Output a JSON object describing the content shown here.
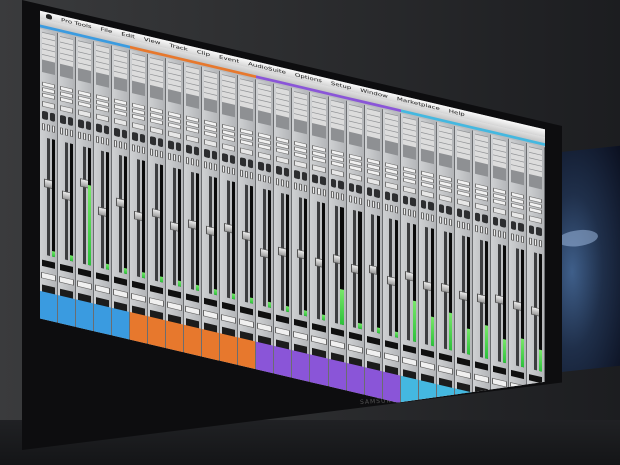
{
  "menubar": {
    "app_name": "Pro Tools",
    "items": [
      "File",
      "Edit",
      "View",
      "Track",
      "Clip",
      "Event",
      "AudioSuite",
      "Options",
      "Setup",
      "Window",
      "Marketplace",
      "Help"
    ]
  },
  "monitor": {
    "brand": "SAMSUNG"
  },
  "mixer": {
    "strip_count": 28,
    "top_color_groups": [
      "#3a9be0",
      "#3a9be0",
      "#3a9be0",
      "#3a9be0",
      "#3a9be0",
      "#e7782d",
      "#e7782d",
      "#e7782d",
      "#e7782d",
      "#e7782d",
      "#e7782d",
      "#e7782d",
      "#8a55d8",
      "#8a55d8",
      "#8a55d8",
      "#8a55d8",
      "#8a55d8",
      "#8a55d8",
      "#8a55d8",
      "#8a55d8",
      "#44b8e0",
      "#44b8e0",
      "#44b8e0",
      "#44b8e0",
      "#44b8e0",
      "#44b8e0",
      "#44b8e0",
      "#44b8e0"
    ],
    "fader_levels": [
      0.62,
      0.55,
      0.7,
      0.48,
      0.6,
      0.52,
      0.58,
      0.5,
      0.56,
      0.54,
      0.6,
      0.57,
      0.45,
      0.5,
      0.52,
      0.48,
      0.55,
      0.5,
      0.53,
      0.47,
      0.55,
      0.5,
      0.52,
      0.49,
      0.5,
      0.53,
      0.51,
      0.5
    ],
    "meter_levels": [
      0.05,
      0.05,
      0.68,
      0.05,
      0.05,
      0.05,
      0.05,
      0.05,
      0.05,
      0.05,
      0.05,
      0.05,
      0.05,
      0.05,
      0.05,
      0.05,
      0.3,
      0.05,
      0.05,
      0.05,
      0.35,
      0.25,
      0.32,
      0.22,
      0.28,
      0.2,
      0.24,
      0.18
    ]
  }
}
